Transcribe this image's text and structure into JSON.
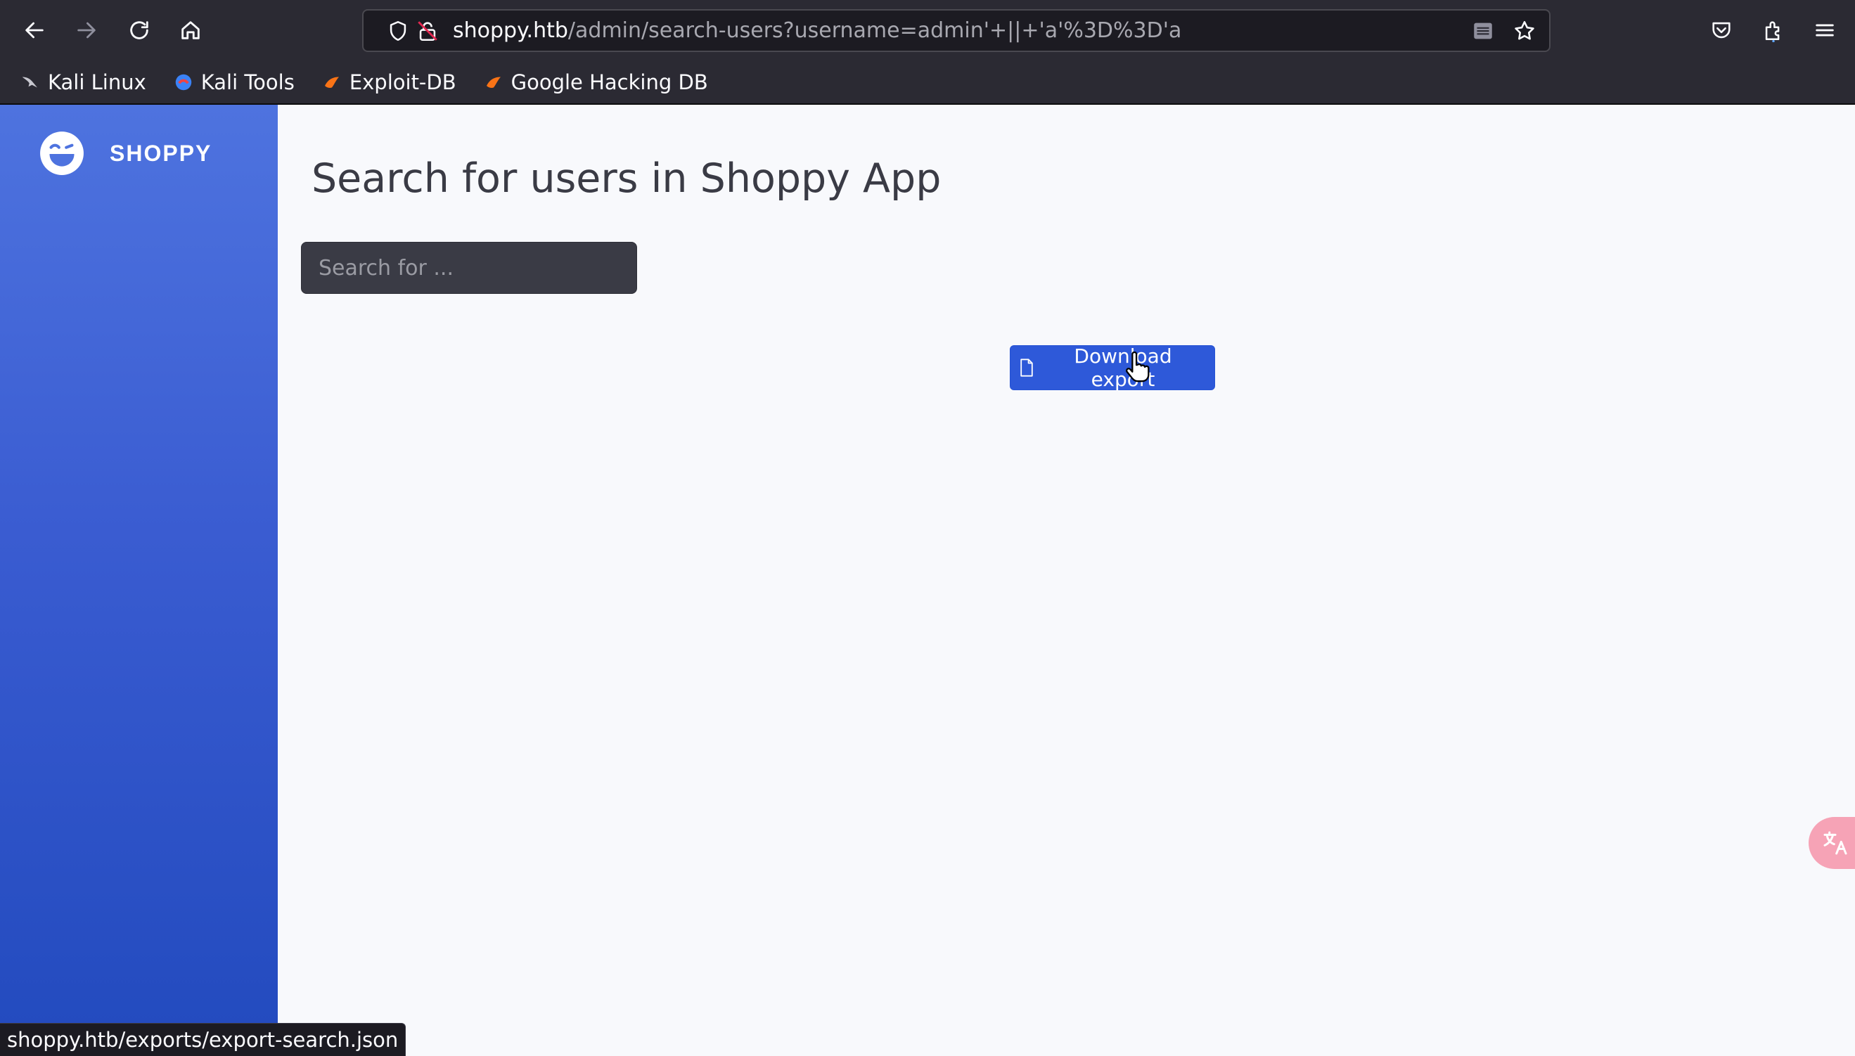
{
  "browser": {
    "url_host": "shoppy.htb",
    "url_path": "/admin/search-users?username=admin'+||+'a'%3D%3D'a",
    "bookmarks": [
      {
        "label": "Kali Linux",
        "icon": "kali-linux-icon"
      },
      {
        "label": "Kali Tools",
        "icon": "kali-tools-icon"
      },
      {
        "label": "Exploit-DB",
        "icon": "exploit-db-icon"
      },
      {
        "label": "Google Hacking DB",
        "icon": "ghdb-icon"
      }
    ],
    "status_text": "shoppy.htb/exports/export-search.json"
  },
  "sidebar": {
    "brand_name": "SHOPPY",
    "brand_icon": "laugh-wink-icon"
  },
  "main": {
    "title": "Search for users in Shoppy App",
    "search_placeholder": "Search for ...",
    "search_value": "",
    "export_button_label": "Download export"
  },
  "colors": {
    "sidebar_top": "#4e73df",
    "sidebar_bottom": "#224abe",
    "button": "#2e59d9",
    "page_bg": "#f8f9fc",
    "chrome_bg": "#2b2a33"
  }
}
